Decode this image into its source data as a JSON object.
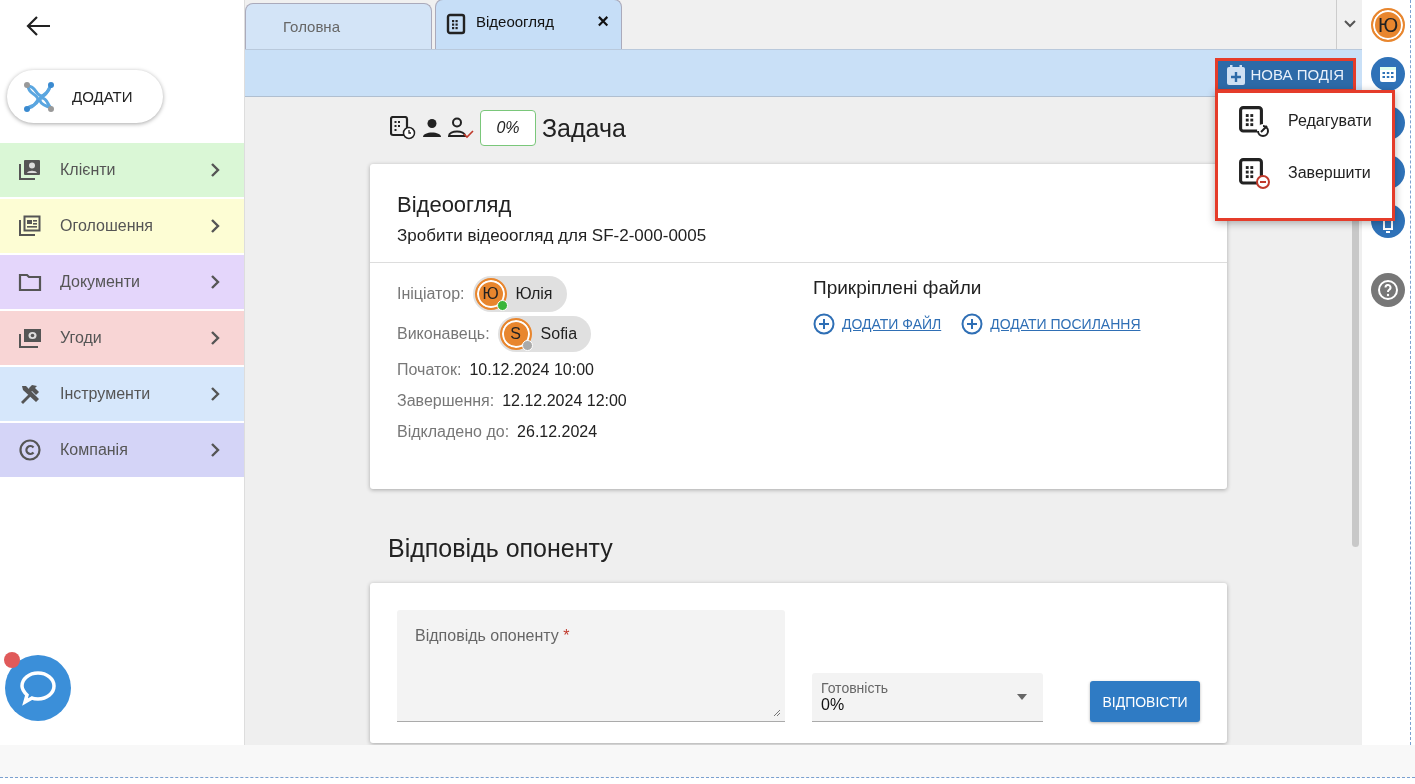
{
  "sidebar": {
    "add_button": "ДОДАТИ",
    "items": [
      {
        "label": "Клієнти",
        "color": "#daf7d6",
        "kind": "clients"
      },
      {
        "label": "Оголошення",
        "color": "#fdfdd4",
        "kind": "ads"
      },
      {
        "label": "Документи",
        "color": "#e4d6fb",
        "kind": "docs"
      },
      {
        "label": "Угоди",
        "color": "#f8d5d5",
        "kind": "deals"
      },
      {
        "label": "Інструменти",
        "color": "#d6e7fb",
        "kind": "tools"
      },
      {
        "label": "Компанія",
        "color": "#d4d4f7",
        "kind": "company"
      }
    ]
  },
  "tabs": [
    {
      "label": "Головна",
      "selected": false,
      "kind": "home",
      "closable": false
    },
    {
      "label": "Відеоогляд",
      "selected": true,
      "kind": "task",
      "closable": true,
      "close": "×"
    }
  ],
  "toolbar": {
    "new_event_button": "НОВА ПОДІЯ",
    "menu": [
      {
        "label": "Редагувати",
        "kind": "edit"
      },
      {
        "label": "Завершити",
        "kind": "finish"
      }
    ]
  },
  "task": {
    "progress": "0%",
    "type_label": "Задача",
    "title": "Відеоогляд",
    "description": "Зробити відеоогляд для SF-2-000-0005",
    "fields": [
      {
        "label": "Ініціатор:",
        "kind": "person",
        "avatar": "Ю",
        "value": "Юлія",
        "online": true
      },
      {
        "label": "Виконавець:",
        "kind": "person",
        "avatar": "S",
        "value": "Sofia",
        "online": false
      },
      {
        "label": "Початок:",
        "kind": "text",
        "value": "10.12.2024 10:00"
      },
      {
        "label": "Завершення:",
        "kind": "text",
        "value": "12.12.2024 12:00"
      },
      {
        "label": "Відкладено до:",
        "kind": "text",
        "value": "26.12.2024"
      }
    ],
    "attachments": {
      "title": "Прикріплені файли",
      "links": [
        "ДОДАТИ ФАЙЛ",
        "ДОДАТИ ПОСИЛАННЯ"
      ]
    }
  },
  "reply": {
    "title": "Відповідь опоненту",
    "textarea_label": "Відповідь опоненту",
    "required_mark": "*",
    "readiness_label": "Готовність",
    "readiness_value": "0%",
    "submit_button": "ВІДПОВІСТИ"
  },
  "rail": {
    "user_avatar": "Ю"
  },
  "chat": {
    "unread": true
  }
}
